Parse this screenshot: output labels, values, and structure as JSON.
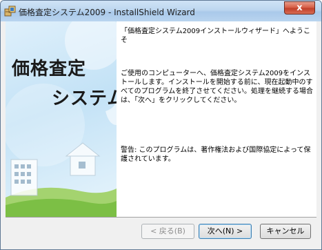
{
  "window": {
    "title": "価格査定システム2009 - InstallShield Wizard",
    "close_symbol": "x",
    "icon": "installer-icon"
  },
  "banner": {
    "title_line1": "価格査定",
    "title_line2": "システム"
  },
  "content": {
    "welcome_title": "「価格査定システム2009インストールウィザード」へようこそ",
    "intro_text": "ご使用のコンピューターへ、価格査定システム2009をインストールします。インストールを開始する前に、現在起動中のすべてのプログラムを終了させてください。処理を継続する場合は、「次へ」をクリックしてください。",
    "warning_text": "警告: このプログラムは、著作権法および国際協定によって保護されています。"
  },
  "buttons": {
    "back": "< 戻る(B)",
    "next": "次へ(N) >",
    "cancel": "キャンセル"
  },
  "colors": {
    "title_bar": "#bdd6ef",
    "close_button": "#c9462f",
    "banner_bg": "#cfe8f7",
    "banner_accent": "#6fb43c",
    "content_bg": "#ffffff"
  }
}
